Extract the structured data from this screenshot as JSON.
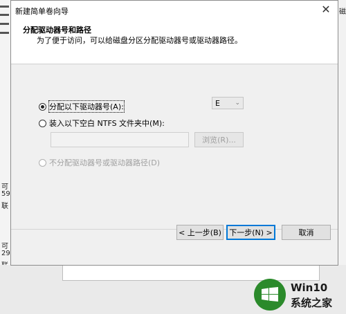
{
  "background": {
    "left_fragments": [
      "可",
      "59",
      "联",
      "可",
      "29",
      "联"
    ],
    "right_fragment": "磁"
  },
  "dialog": {
    "title": "新建简单卷向导",
    "close_glyph": "✕",
    "header_title": "分配驱动器号和路径",
    "header_subtitle": "为了便于访问，可以给磁盘分区分配驱动器号或驱动器路径。",
    "options": {
      "assign_letter": "分配以下驱动器号(A):",
      "mount_folder": "装入以下空白 NTFS 文件夹中(M):",
      "no_assign": "不分配驱动器号或驱动器路径(D)"
    },
    "drive_letter_value": "E",
    "folder_path_value": "",
    "browse_label": "浏览(R)...",
    "buttons": {
      "back": "< 上一步(B)",
      "next": "下一步(N) >",
      "cancel": "取消"
    }
  },
  "watermark": {
    "line1": "Win10",
    "line2": "系统之家"
  },
  "colors": {
    "accent": "#0078d7",
    "logo_green": "#2b8a2b"
  }
}
